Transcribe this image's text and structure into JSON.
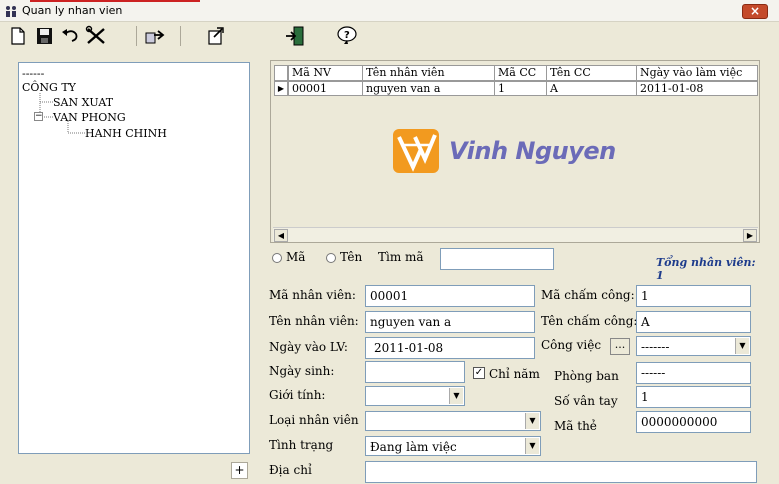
{
  "window": {
    "title": "Quan ly nhan vien",
    "close_label": "×"
  },
  "toolbar": {
    "icons": [
      "new-file-icon",
      "save-icon",
      "undo-icon",
      "tools-icon",
      "export-icon",
      "edit-note-icon",
      "exit-door-icon",
      "help-icon"
    ]
  },
  "tree": {
    "root_dash": "------",
    "company": "CÔNG TY",
    "node1": "SAN XUAT",
    "node2": "VAN PHONG",
    "node2_toggle": "−",
    "node3": "HANH CHINH",
    "add_label": "+"
  },
  "grid": {
    "columns": [
      "Mã NV",
      "Tên nhân viên",
      "Mã CC",
      "Tên CC",
      "Ngày vào làm việc"
    ],
    "rows": [
      [
        "00001",
        "nguyen van a",
        "1",
        "A",
        "2011-01-08"
      ]
    ],
    "row_marker": "▶",
    "scroll_left": "◀",
    "scroll_right": "▶",
    "logo_text": "Vinh Nguyen"
  },
  "search": {
    "radio_code": "Mã",
    "radio_name": "Tên",
    "find_label": "Tìm mã",
    "find_value": "",
    "total_label": "Tổng nhân viên: 1"
  },
  "form": {
    "emp_code_label": "Mã nhân viên:",
    "emp_code_value": "00001",
    "emp_name_label": "Tên nhân viên:",
    "emp_name_value": "nguyen van a",
    "start_date_label": "Ngày vào LV:",
    "start_date_value": "2011-01-08",
    "birth_label": "Ngày sinh:",
    "birth_value": "",
    "year_only_label": "Chỉ năm",
    "year_only_check": "✓",
    "gender_label": "Giới tính:",
    "gender_value": "",
    "emp_type_label": "Loại nhân viên",
    "emp_type_value": "",
    "status_label": "Tình trạng",
    "status_value": "Đang làm việc",
    "address_label": "Địa chỉ",
    "address_value": "",
    "att_code_label": "Mã chấm công:",
    "att_code_value": "1",
    "att_name_label": "Tên chấm công:",
    "att_name_value": "A",
    "job_label": "Công việc",
    "job_button": "...",
    "job_value": "-------",
    "dept_label": "Phòng ban",
    "dept_value": "------",
    "fingerprint_label": "Số vân tay",
    "fingerprint_value": "1",
    "card_label": "Mã thẻ",
    "card_value": "0000000000",
    "dropdown_arrow": "▼"
  }
}
